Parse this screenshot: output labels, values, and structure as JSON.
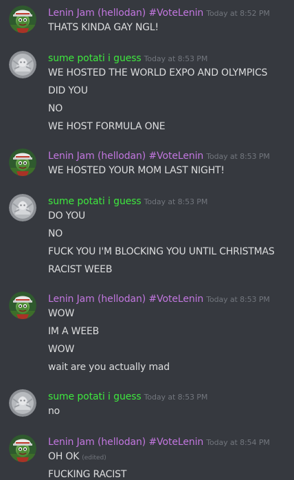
{
  "users": {
    "lenin": {
      "name": "Lenin Jam (hellodan) #VoteLenin",
      "color": "#c377e0"
    },
    "potati": {
      "name": "sume potati i guess",
      "color": "#3ee83e"
    }
  },
  "groups": [
    {
      "user": "lenin",
      "timestamp": "Today at 8:52 PM",
      "lines": [
        {
          "text": "THATS KINDA GAY NGL!"
        }
      ]
    },
    {
      "user": "potati",
      "timestamp": "Today at 8:53 PM",
      "lines": [
        {
          "text": "WE HOSTED THE WORLD EXPO AND OLYMPICS"
        },
        {
          "text": "DID YOU"
        },
        {
          "text": "NO"
        },
        {
          "text": "WE HOST FORMULA ONE"
        }
      ]
    },
    {
      "user": "lenin",
      "timestamp": "Today at 8:53 PM",
      "lines": [
        {
          "text": "WE HOSTED YOUR MOM LAST NIGHT!"
        }
      ]
    },
    {
      "user": "potati",
      "timestamp": "Today at 8:53 PM",
      "lines": [
        {
          "text": "DO YOU"
        },
        {
          "text": "NO"
        },
        {
          "text": "FUCK YOU I'M BLOCKING YOU UNTIL CHRISTMAS"
        },
        {
          "text": "RACIST WEEB"
        }
      ]
    },
    {
      "user": "lenin",
      "timestamp": "Today at 8:53 PM",
      "lines": [
        {
          "text": "WOW"
        },
        {
          "text": "IM A WEEB"
        },
        {
          "text": "WOW"
        },
        {
          "text": "wait are you actually mad"
        }
      ]
    },
    {
      "user": "potati",
      "timestamp": "Today at 8:53 PM",
      "lines": [
        {
          "text": "no"
        }
      ]
    },
    {
      "user": "lenin",
      "timestamp": "Today at 8:54 PM",
      "lines": [
        {
          "text": "OH OK",
          "edited": "(edited)"
        },
        {
          "text": "FUCKING RACIST"
        }
      ]
    }
  ]
}
